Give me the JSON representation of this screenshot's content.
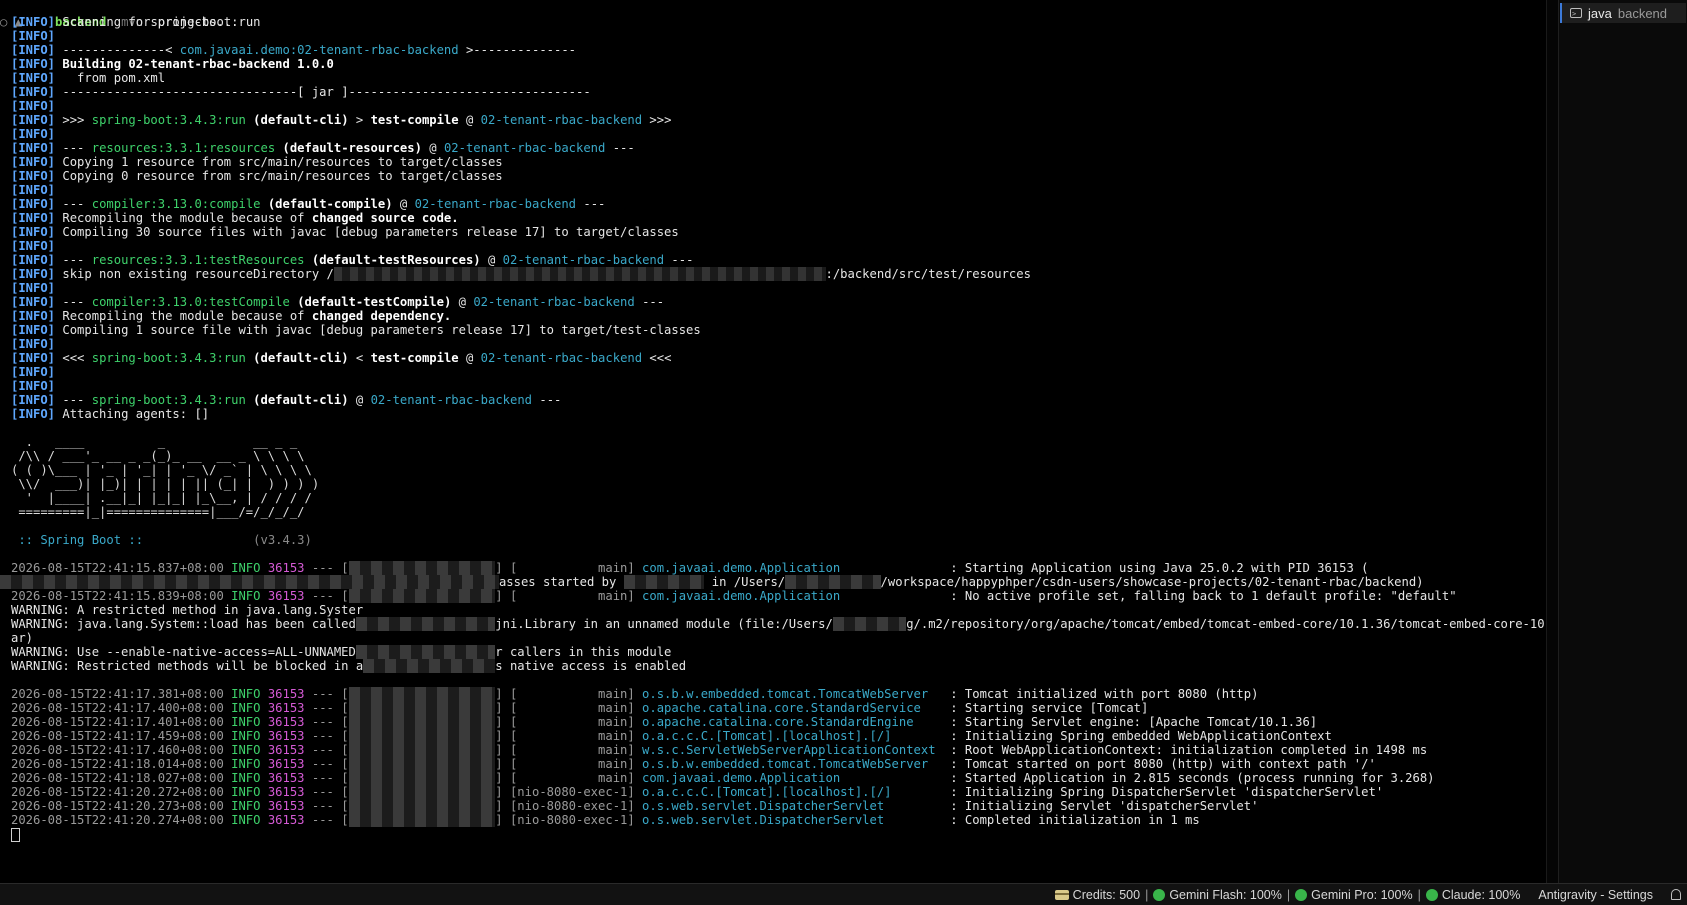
{
  "terminal": {
    "prompt": {
      "dir": "backend",
      "cmd": "mvn",
      "args": "spring-boot:run"
    },
    "info_tag": "[INFO]",
    "maven_lines": [
      {
        "segs": [
          {
            "t": "Scanning for projects..."
          }
        ]
      },
      {
        "segs": []
      },
      {
        "segs": [
          {
            "t": "--------------< "
          },
          {
            "t": "com.javaai.demo:02-tenant-rbac-backend",
            "c": "cyan"
          },
          {
            "t": " >--------------"
          }
        ]
      },
      {
        "segs": [
          {
            "t": "Building 02-tenant-rbac-backend 1.0.0",
            "c": "bold"
          }
        ]
      },
      {
        "segs": [
          {
            "t": "  from pom.xml"
          }
        ]
      },
      {
        "segs": [
          {
            "t": "--------------------------------[ jar ]---------------------------------"
          }
        ]
      },
      {
        "segs": []
      },
      {
        "segs": [
          {
            "t": ">>> "
          },
          {
            "t": "spring-boot:3.4.3:run",
            "c": "green"
          },
          {
            "t": " (default-cli)",
            "c": "bold"
          },
          {
            "t": " > "
          },
          {
            "t": "test-compile",
            "c": "bold"
          },
          {
            "t": " @ "
          },
          {
            "t": "02-tenant-rbac-backend",
            "c": "cyan"
          },
          {
            "t": " >>>"
          }
        ]
      },
      {
        "segs": []
      },
      {
        "segs": [
          {
            "t": "--- "
          },
          {
            "t": "resources:3.3.1:resources",
            "c": "green"
          },
          {
            "t": " (default-resources)",
            "c": "bold"
          },
          {
            "t": " @ "
          },
          {
            "t": "02-tenant-rbac-backend",
            "c": "cyan"
          },
          {
            "t": " ---"
          }
        ]
      },
      {
        "segs": [
          {
            "t": "Copying 1 resource from src/main/resources to target/classes"
          }
        ]
      },
      {
        "segs": [
          {
            "t": "Copying 0 resource from src/main/resources to target/classes"
          }
        ]
      },
      {
        "segs": []
      },
      {
        "segs": [
          {
            "t": "--- "
          },
          {
            "t": "compiler:3.13.0:compile",
            "c": "green"
          },
          {
            "t": " (default-compile)",
            "c": "bold"
          },
          {
            "t": " @ "
          },
          {
            "t": "02-tenant-rbac-backend",
            "c": "cyan"
          },
          {
            "t": " ---"
          }
        ]
      },
      {
        "segs": [
          {
            "t": "Recompiling the module because of "
          },
          {
            "t": "changed source code.",
            "c": "bold"
          }
        ]
      },
      {
        "segs": [
          {
            "t": "Compiling 30 source files with javac [debug parameters release 17] to target/classes"
          }
        ]
      },
      {
        "segs": []
      },
      {
        "segs": [
          {
            "t": "--- "
          },
          {
            "t": "resources:3.3.1:testResources",
            "c": "green"
          },
          {
            "t": " (default-testResources)",
            "c": "bold"
          },
          {
            "t": " @ "
          },
          {
            "t": "02-tenant-rbac-backend",
            "c": "cyan"
          },
          {
            "t": " ---"
          }
        ]
      },
      {
        "segs": [
          {
            "t": "skip non existing resourceDirectory /"
          },
          {
            "t": "                                                                   "
          },
          {
            "t": ":/backend/src/test/resources"
          }
        ]
      },
      {
        "segs": []
      },
      {
        "segs": [
          {
            "t": "--- "
          },
          {
            "t": "compiler:3.13.0:testCompile",
            "c": "green"
          },
          {
            "t": " (default-testCompile)",
            "c": "bold"
          },
          {
            "t": " @ "
          },
          {
            "t": "02-tenant-rbac-backend",
            "c": "cyan"
          },
          {
            "t": " ---"
          }
        ]
      },
      {
        "segs": [
          {
            "t": "Recompiling the module because of "
          },
          {
            "t": "changed dependency.",
            "c": "bold"
          }
        ]
      },
      {
        "segs": [
          {
            "t": "Compiling 1 source file with javac [debug parameters release 17] to target/test-classes"
          }
        ]
      },
      {
        "segs": []
      },
      {
        "segs": [
          {
            "t": "<<< "
          },
          {
            "t": "spring-boot:3.4.3:run",
            "c": "green"
          },
          {
            "t": " (default-cli)",
            "c": "bold"
          },
          {
            "t": " < "
          },
          {
            "t": "test-compile",
            "c": "bold"
          },
          {
            "t": " @ "
          },
          {
            "t": "02-tenant-rbac-backend",
            "c": "cyan"
          },
          {
            "t": " <<<"
          }
        ]
      },
      {
        "segs": []
      },
      {
        "segs": []
      },
      {
        "segs": [
          {
            "t": "--- "
          },
          {
            "t": "spring-boot:3.4.3:run",
            "c": "green"
          },
          {
            "t": " (default-cli)",
            "c": "bold"
          },
          {
            "t": " @ "
          },
          {
            "t": "02-tenant-rbac-backend",
            "c": "cyan"
          },
          {
            "t": " ---"
          }
        ]
      },
      {
        "segs": [
          {
            "t": "Attaching agents: []"
          }
        ]
      }
    ],
    "banner": [
      "",
      "  .   ____          _            __ _ _",
      " /\\\\ / ___'_ __ _ _(_)_ __  __ _ \\ \\ \\ \\",
      "( ( )\\___ | '_ | '_| | '_ \\/ _` | \\ \\ \\ \\",
      " \\\\/  ___)| |_)| | | | | || (_| |  ) ) ) )",
      "  '  |____| .__|_| |_|_| |_\\__, | / / / /",
      " =========|_|==============|___/=/_/_/_/",
      ""
    ],
    "spring_label": " :: Spring Boot :: ",
    "spring_version": "              (v3.4.3)",
    "log_lines": [
      {
        "kind": "log",
        "time": "2026-08-15T22:41:15.837+08:00",
        "level": " INFO",
        "pid": "36153",
        "sep": " --- [",
        "redact": "                    ",
        "thread": "] [           main] ",
        "logger": "com.javaai.demo.Application",
        "pad": "              ",
        "msg": " : Starting Application using Java 25.0.2 with PID 36153 ("
      },
      {
        "kind": "raw",
        "segs": [
          {
            "t": "                                                                    "
          },
          {
            "t": "asses started by "
          },
          {
            "t": "           "
          },
          {
            "t": " in /Users/"
          },
          {
            "t": "             "
          },
          {
            "t": "/workspace/happyphper/csdn-users/showcase-projects/02-tenant-rbac/backend)"
          }
        ],
        "indent": -11
      },
      {
        "kind": "log",
        "time": "2026-08-15T22:41:15.839+08:00",
        "level": " INFO",
        "pid": "36153",
        "sep": " --- [",
        "redact": "                    ",
        "thread": "] [           main] ",
        "logger": "com.javaai.demo.Application",
        "pad": "              ",
        "msg": " : No active profile set, falling back to 1 default profile: \"default\""
      },
      {
        "kind": "raw",
        "segs": [
          {
            "t": "WARNING: A restricted method in java.lang.Syster"
          }
        ]
      },
      {
        "kind": "raw",
        "segs": [
          {
            "t": "WARNING: java.lang.System::load has been called"
          },
          {
            "t": "                   "
          },
          {
            "t": "jni.Library in an unnamed module (file:/Users/"
          },
          {
            "t": "          "
          },
          {
            "t": "g/.m2/repository/org/apache/tomcat/embed/tomcat-embed-core/10.1.36/tomcat-embed-core-10.1.36.j"
          }
        ]
      },
      {
        "kind": "raw",
        "segs": [
          {
            "t": "ar)"
          }
        ]
      },
      {
        "kind": "raw",
        "segs": [
          {
            "t": "WARNING: Use --enable-native-access=ALL-UNNAMED"
          },
          {
            "t": "                   "
          },
          {
            "t": "r callers in this module"
          }
        ]
      },
      {
        "kind": "raw",
        "segs": [
          {
            "t": "WARNING: Restricted methods will be blocked in a"
          },
          {
            "t": "                  "
          },
          {
            "t": "s native access is enabled"
          }
        ]
      },
      {
        "kind": "raw",
        "segs": []
      },
      {
        "kind": "log",
        "time": "2026-08-15T22:41:17.381+08:00",
        "level": " INFO",
        "pid": "36153",
        "sep": " --- [",
        "redact": "                    ",
        "thread": "] [           main] ",
        "logger": "o.s.b.w.embedded.tomcat.TomcatWebServer",
        "pad": "  ",
        "msg": " : Tomcat initialized with port 8080 (http)"
      },
      {
        "kind": "log",
        "time": "2026-08-15T22:41:17.400+08:00",
        "level": " INFO",
        "pid": "36153",
        "sep": " --- [",
        "redact": "                    ",
        "thread": "] [           main] ",
        "logger": "o.apache.catalina.core.StandardService",
        "pad": "   ",
        "msg": " : Starting service [Tomcat]"
      },
      {
        "kind": "log",
        "time": "2026-08-15T22:41:17.401+08:00",
        "level": " INFO",
        "pid": "36153",
        "sep": " --- [",
        "redact": "                    ",
        "thread": "] [           main] ",
        "logger": "o.apache.catalina.core.StandardEngine",
        "pad": "    ",
        "msg": " : Starting Servlet engine: [Apache Tomcat/10.1.36]"
      },
      {
        "kind": "log",
        "time": "2026-08-15T22:41:17.459+08:00",
        "level": " INFO",
        "pid": "36153",
        "sep": " --- [",
        "redact": "                    ",
        "thread": "] [           main] ",
        "logger": "o.a.c.c.C.[Tomcat].[localhost].[/]",
        "pad": "       ",
        "msg": " : Initializing Spring embedded WebApplicationContext"
      },
      {
        "kind": "log",
        "time": "2026-08-15T22:41:17.460+08:00",
        "level": " INFO",
        "pid": "36153",
        "sep": " --- [",
        "redact": "                    ",
        "thread": "] [           main] ",
        "logger": "w.s.c.ServletWebServerApplicationContext",
        "pad": " ",
        "msg": " : Root WebApplicationContext: initialization completed in 1498 ms"
      },
      {
        "kind": "log",
        "time": "2026-08-15T22:41:18.014+08:00",
        "level": " INFO",
        "pid": "36153",
        "sep": " --- [",
        "redact": "                    ",
        "thread": "] [           main] ",
        "logger": "o.s.b.w.embedded.tomcat.TomcatWebServer",
        "pad": "  ",
        "msg": " : Tomcat started on port 8080 (http) with context path '/'"
      },
      {
        "kind": "log",
        "time": "2026-08-15T22:41:18.027+08:00",
        "level": " INFO",
        "pid": "36153",
        "sep": " --- [",
        "redact": "                    ",
        "thread": "] [           main] ",
        "logger": "com.javaai.demo.Application",
        "pad": "              ",
        "msg": " : Started Application in 2.815 seconds (process running for 3.268)"
      },
      {
        "kind": "log",
        "time": "2026-08-15T22:41:20.272+08:00",
        "level": " INFO",
        "pid": "36153",
        "sep": " --- [",
        "redact": "                    ",
        "thread": "] [nio-8080-exec-1] ",
        "logger": "o.a.c.c.C.[Tomcat].[localhost].[/]",
        "pad": "       ",
        "msg": " : Initializing Spring DispatcherServlet 'dispatcherServlet'"
      },
      {
        "kind": "log",
        "time": "2026-08-15T22:41:20.273+08:00",
        "level": " INFO",
        "pid": "36153",
        "sep": " --- [",
        "redact": "                    ",
        "thread": "] [nio-8080-exec-1] ",
        "logger": "o.s.web.servlet.DispatcherServlet",
        "pad": "        ",
        "msg": " : Initializing Servlet 'dispatcherServlet'"
      },
      {
        "kind": "log",
        "time": "2026-08-15T22:41:20.274+08:00",
        "level": " INFO",
        "pid": "36153",
        "sep": " --- [",
        "redact": "                    ",
        "thread": "] [nio-8080-exec-1] ",
        "logger": "o.s.web.servlet.DispatcherServlet",
        "pad": "        ",
        "msg": " : Completed initialization in 1 ms"
      }
    ]
  },
  "side_panel": {
    "tab_icon": "terminal-icon",
    "tab_name": "java",
    "tab_sub": "backend"
  },
  "status_bar": {
    "credits": "Credits: 500",
    "gemini_flash": "Gemini Flash: 100%",
    "gemini_pro": "Gemini Pro: 100%",
    "claude": "Claude: 100%",
    "settings": "Antigravity - Settings",
    "separator": "|",
    "ok_color": "#39b54a"
  }
}
